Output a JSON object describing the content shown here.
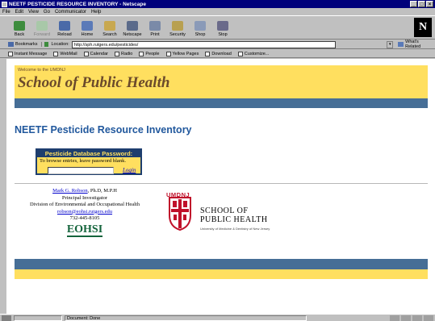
{
  "window": {
    "title": "NEETF PESTICIDE RESOURCE INVENTORY - Netscape"
  },
  "menu": [
    "File",
    "Edit",
    "View",
    "Go",
    "Communicator",
    "Help"
  ],
  "toolbar": {
    "back": "Back",
    "forward": "Forward",
    "reload": "Reload",
    "home": "Home",
    "search": "Search",
    "netscape": "Netscape",
    "print": "Print",
    "security": "Security",
    "shop": "Shop",
    "stop": "Stop"
  },
  "location": {
    "bookmarks_label": "Bookmarks",
    "location_label": "Location:",
    "url": "http://sph.rutgers.edu/pesticides/",
    "whats_related": "What's Related"
  },
  "personal_bar": [
    "Instant Message",
    "WebMail",
    "Calendar",
    "Radio",
    "People",
    "Yellow Pages",
    "Download",
    "Customize..."
  ],
  "page": {
    "banner_welcome": "Welcome to the UMDNJ",
    "banner_school": "School of Public Health",
    "title": "NEETF Pesticide Resource Inventory",
    "pw_heading": "Pesticide Database Password:",
    "pw_hint": "To browse entries, leave password blank.",
    "pw_value": "",
    "login_link": "Login",
    "contact": {
      "name_link": "Mark G. Robson",
      "name_suffix": ", Ph.D, M.P.H",
      "role": "Principal Investigator",
      "division": "Division of Environmental and Occupational Health",
      "email": "robson@eohsi.rutgers.edu",
      "phone": "732-445-8105",
      "org_logo": "EOHSI"
    },
    "umdnj_logo": {
      "acronym": "UMDNJ",
      "line1": "SCHOOL OF",
      "line2": "PUBLIC HEALTH",
      "subline": "University of Medicine & Dentistry of New Jersey"
    }
  },
  "status": {
    "text": "Document: Done"
  },
  "colors": {
    "banner_yellow": "#ffdf5f",
    "band_blue": "#466e96",
    "title_blue": "#21589d",
    "pw_navy": "#1e3e6e",
    "umdnj_red": "#c0102a",
    "eohsi_green": "#14643c"
  }
}
